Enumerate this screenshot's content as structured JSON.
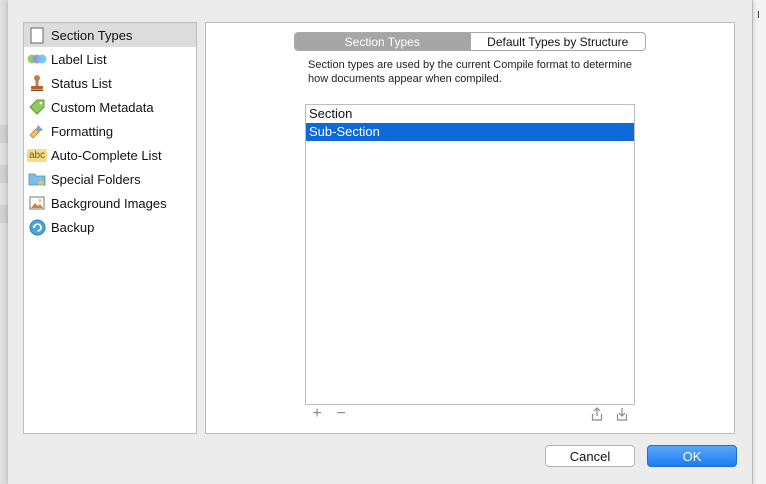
{
  "sidebar": {
    "items": [
      {
        "label": "Section Types",
        "icon": "document-icon",
        "selected": true
      },
      {
        "label": "Label List",
        "icon": "label-circles-icon"
      },
      {
        "label": "Status List",
        "icon": "stamp-icon"
      },
      {
        "label": "Custom Metadata",
        "icon": "tag-icon"
      },
      {
        "label": "Formatting",
        "icon": "paintbrush-icon"
      },
      {
        "label": "Auto-Complete List",
        "icon": "abc-icon",
        "icon_text": "abc"
      },
      {
        "label": "Special Folders",
        "icon": "star-folder-icon"
      },
      {
        "label": "Background Images",
        "icon": "picture-icon"
      },
      {
        "label": "Backup",
        "icon": "backup-icon"
      }
    ]
  },
  "tabs": {
    "active": "Section Types",
    "other": "Default Types by Structure"
  },
  "description": "Section types are used by the current Compile format to determine how documents appear when compiled.",
  "list": {
    "items": [
      "Section",
      "Sub-Section"
    ],
    "selected_index": 1
  },
  "list_tools": {
    "add": "+",
    "remove": "−"
  },
  "buttons": {
    "cancel": "Cancel",
    "ok": "OK"
  },
  "colors": {
    "selection_blue": "#0e6ad8",
    "ok_button": "#1c7cf2"
  }
}
